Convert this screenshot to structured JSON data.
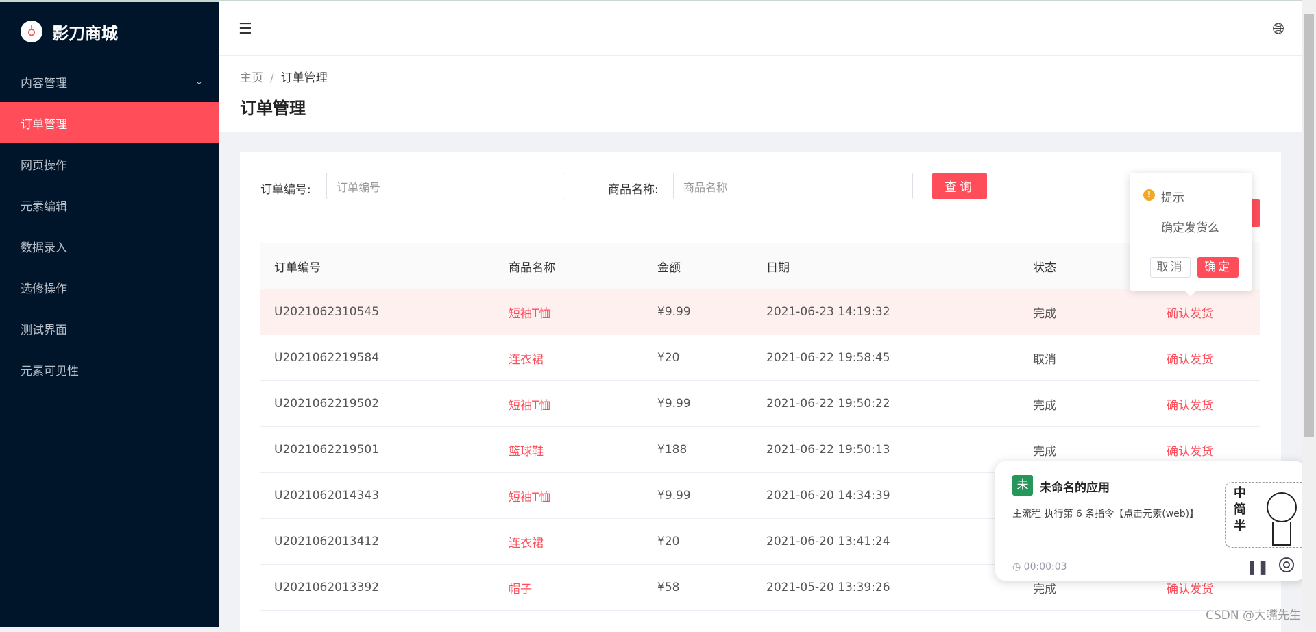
{
  "brand": {
    "name": "影刀商城",
    "logo_icon": "knife-logo"
  },
  "sidebar": {
    "items": [
      {
        "label": "内容管理",
        "expandable": true
      },
      {
        "label": "订单管理",
        "active": true
      },
      {
        "label": "网页操作"
      },
      {
        "label": "元素编辑"
      },
      {
        "label": "数据录入"
      },
      {
        "label": "选修操作"
      },
      {
        "label": "测试界面"
      },
      {
        "label": "元素可见性"
      }
    ]
  },
  "breadcrumb": {
    "home": "主页",
    "sep": "/",
    "current": "订单管理"
  },
  "page_title": "订单管理",
  "search": {
    "order_label": "订单编号:",
    "order_placeholder": "订单编号",
    "product_label": "商品名称:",
    "product_placeholder": "商品名称",
    "query_label": "查询"
  },
  "table": {
    "headers": [
      "订单编号",
      "商品名称",
      "金额",
      "日期",
      "状态"
    ],
    "rows": [
      {
        "id": "U2021062310545",
        "product": "短袖T恤",
        "amount": "¥9.99",
        "date": "2021-06-23 14:19:32",
        "status": "完成",
        "action": "确认发货"
      },
      {
        "id": "U2021062219584",
        "product": "连衣裙",
        "amount": "¥20",
        "date": "2021-06-22 19:58:45",
        "status": "取消",
        "action": "确认发货"
      },
      {
        "id": "U2021062219502",
        "product": "短袖T恤",
        "amount": "¥9.99",
        "date": "2021-06-22 19:50:22",
        "status": "完成",
        "action": "确认发货"
      },
      {
        "id": "U2021062219501",
        "product": "篮球鞋",
        "amount": "¥188",
        "date": "2021-06-22 19:50:13",
        "status": "完成",
        "action": "确认发货"
      },
      {
        "id": "U2021062014343",
        "product": "短袖T恤",
        "amount": "¥9.99",
        "date": "2021-06-20 14:34:39",
        "status": "",
        "action": ""
      },
      {
        "id": "U2021062013412",
        "product": "连衣裙",
        "amount": "¥20",
        "date": "2021-06-20 13:41:24",
        "status": "",
        "action": ""
      },
      {
        "id": "U2021062013392",
        "product": "帽子",
        "amount": "¥58",
        "date": "2021-05-20 13:39:26",
        "status": "完成",
        "action": "确认发货"
      }
    ]
  },
  "popconfirm": {
    "title": "提示",
    "message": "确定发货么",
    "cancel": "取消",
    "confirm": "确定"
  },
  "floating_panel": {
    "avatar": "未",
    "app_name": "未命名的应用",
    "status": "主流程 执行第 6 条指令【点击元素(web)】",
    "timer": "00:00:03",
    "sticker_text": "中简半"
  },
  "watermark": "CSDN @大嘴先生",
  "colors": {
    "accent": "#ff4d5a",
    "sidebar": "#001529",
    "warning": "#f5a623",
    "app_badge": "#26965a"
  }
}
